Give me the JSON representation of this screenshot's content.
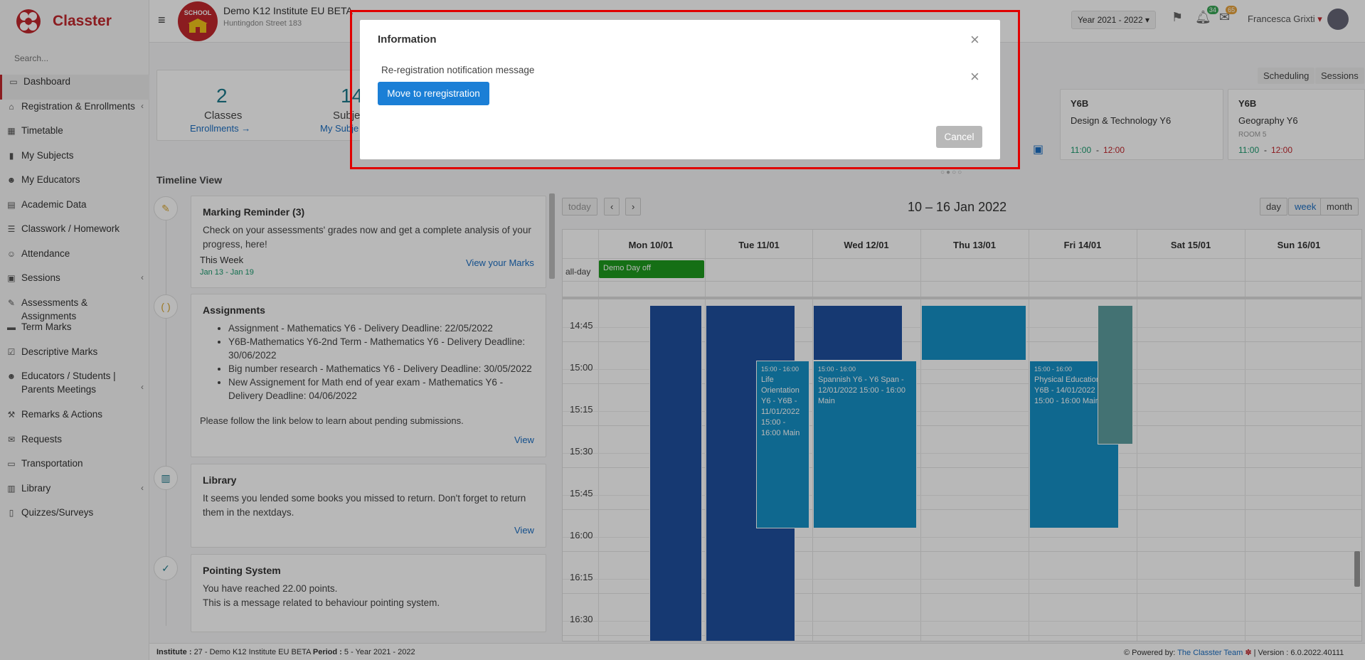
{
  "app": {
    "brand": "Classter"
  },
  "sidebar": {
    "search_placeholder": "Search...",
    "items": [
      {
        "label": "Dashboard",
        "icon": "laptop-icon",
        "active": true
      },
      {
        "label": "Registration & Enrollments",
        "icon": "institution-icon",
        "chevron": true
      },
      {
        "label": "Timetable",
        "icon": "calendar-icon"
      },
      {
        "label": "My Subjects",
        "icon": "book-icon"
      },
      {
        "label": "My Educators",
        "icon": "users-icon"
      },
      {
        "label": "Academic Data",
        "icon": "id-card-icon"
      },
      {
        "label": "Classwork / Homework",
        "icon": "list-icon"
      },
      {
        "label": "Attendance",
        "icon": "user-check-icon"
      },
      {
        "label": "Sessions",
        "icon": "chalkboard-icon",
        "chevron": true
      },
      {
        "label": "Assessments & Assignments",
        "icon": "edit-icon"
      },
      {
        "label": "Term Marks",
        "icon": "marks-icon"
      },
      {
        "label": "Descriptive Marks",
        "icon": "check-square-icon"
      },
      {
        "label": "Educators / Students | Parents Meetings",
        "icon": "meeting-icon",
        "chevron": true
      },
      {
        "label": "Remarks & Actions",
        "icon": "gavel-icon"
      },
      {
        "label": "Requests",
        "icon": "envelope-icon"
      },
      {
        "label": "Transportation",
        "icon": "bus-icon"
      },
      {
        "label": "Library",
        "icon": "library-icon",
        "chevron": true
      },
      {
        "label": "Quizzes/Surveys",
        "icon": "clipboard-icon"
      }
    ]
  },
  "header": {
    "school_badge": "SCHOOL",
    "institute_name": "Demo K12 Institute EU BETA",
    "institute_address": "Huntingdon Street 183",
    "year": "Year 2021 - 2022",
    "notif_count": "34",
    "mail_count": "65",
    "user_name": "Francesca Grixti",
    "colors": {
      "notif_badge": "#3aa757",
      "mail_badge": "#e6a23c"
    }
  },
  "stats": [
    {
      "value": "2",
      "label": "Classes",
      "link": "Enrollments →"
    },
    {
      "value": "14",
      "label": "Subje",
      "link": "My Subje"
    }
  ],
  "schedule_tabs": [
    "Scheduling",
    "Sessions"
  ],
  "upcoming": [
    {
      "class": "Y6B",
      "subject": "Design & Technology Y6",
      "room": "",
      "start": "11:00",
      "end": "12:00"
    },
    {
      "class": "Y6B",
      "subject": "Geography Y6",
      "room": "ROOM 5",
      "start": "11:00",
      "end": "12:00"
    }
  ],
  "timeline": {
    "title": "Timeline View",
    "marking": {
      "title": "Marking Reminder (3)",
      "text": "Check on your assessments' grades now and get a complete analysis of your progress, here!",
      "period_label": "This Week",
      "period_range": "Jan 13 - Jan 19",
      "link": "View your Marks"
    },
    "assignments": {
      "title": "Assignments",
      "items": [
        "Assignment - Mathematics Y6 - Delivery Deadline: 22/05/2022",
        "Y6B-Mathematics Y6-2nd Term - Mathematics Y6 - Delivery Deadline: 30/06/2022",
        "Big number research - Mathematics Y6 - Delivery Deadline: 30/05/2022",
        "New Assignement for Math end of year exam - Mathematics Y6 - Delivery Deadline: 04/06/2022"
      ],
      "note": "Please follow the link below to learn about pending submissions.",
      "link": "View"
    },
    "library": {
      "title": "Library",
      "text": "It seems you lended some books you missed to return. Don't forget to return them in the nextdays.",
      "link": "View"
    },
    "pointing": {
      "title": "Pointing System",
      "text1": "You have reached 22.00 points.",
      "text2": "This is a message related to behaviour pointing system."
    }
  },
  "calendar": {
    "today": "today",
    "prev": "‹",
    "next": "›",
    "title": "10 – 16 Jan 2022",
    "views": [
      "day",
      "week",
      "month"
    ],
    "active_view": "week",
    "days": [
      "Mon 10/01",
      "Tue 11/01",
      "Wed 12/01",
      "Thu 13/01",
      "Fri 14/01",
      "Sat 15/01",
      "Sun 16/01"
    ],
    "allday_label": "all-day",
    "allday_event": "Demo Day off",
    "times": [
      "14:45",
      "15:00",
      "15:15",
      "15:30",
      "15:45",
      "16:00",
      "16:15",
      "16:30"
    ],
    "events": {
      "tue": {
        "time": "15:00 - 16:00",
        "text": "Life Orientation Y6 - Y6B - 11/01/2022 15:00 - 16:00 Main"
      },
      "wed": {
        "time": "15:00 - 16:00",
        "text": "Spannish Y6 - Y6 Span - 12/01/2022 15:00 - 16:00 Main"
      },
      "fri": {
        "time": "15:00 - 16:00",
        "text": "Physical Education - Y6B - 14/01/2022 15:00 - 16:00 Main"
      }
    },
    "colors": {
      "dark": "#1f4f9e",
      "teal": "#1591c7",
      "allday": "#1e9a1e",
      "grayteal": "#5e9ea0"
    }
  },
  "modal": {
    "title": "Information",
    "message": "Re-registration notification message",
    "primary_button": "Move to reregistration",
    "cancel_button": "Cancel"
  },
  "footer": {
    "institute_label": "Institute :",
    "institute_value": "27 - Demo K12 Institute EU BETA",
    "period_label": "Period :",
    "period_value": "5 - Year 2021 - 2022",
    "powered_by": "Powered by:",
    "team": "The Classter Team",
    "version": "| Version : 6.0.2022.40111"
  }
}
